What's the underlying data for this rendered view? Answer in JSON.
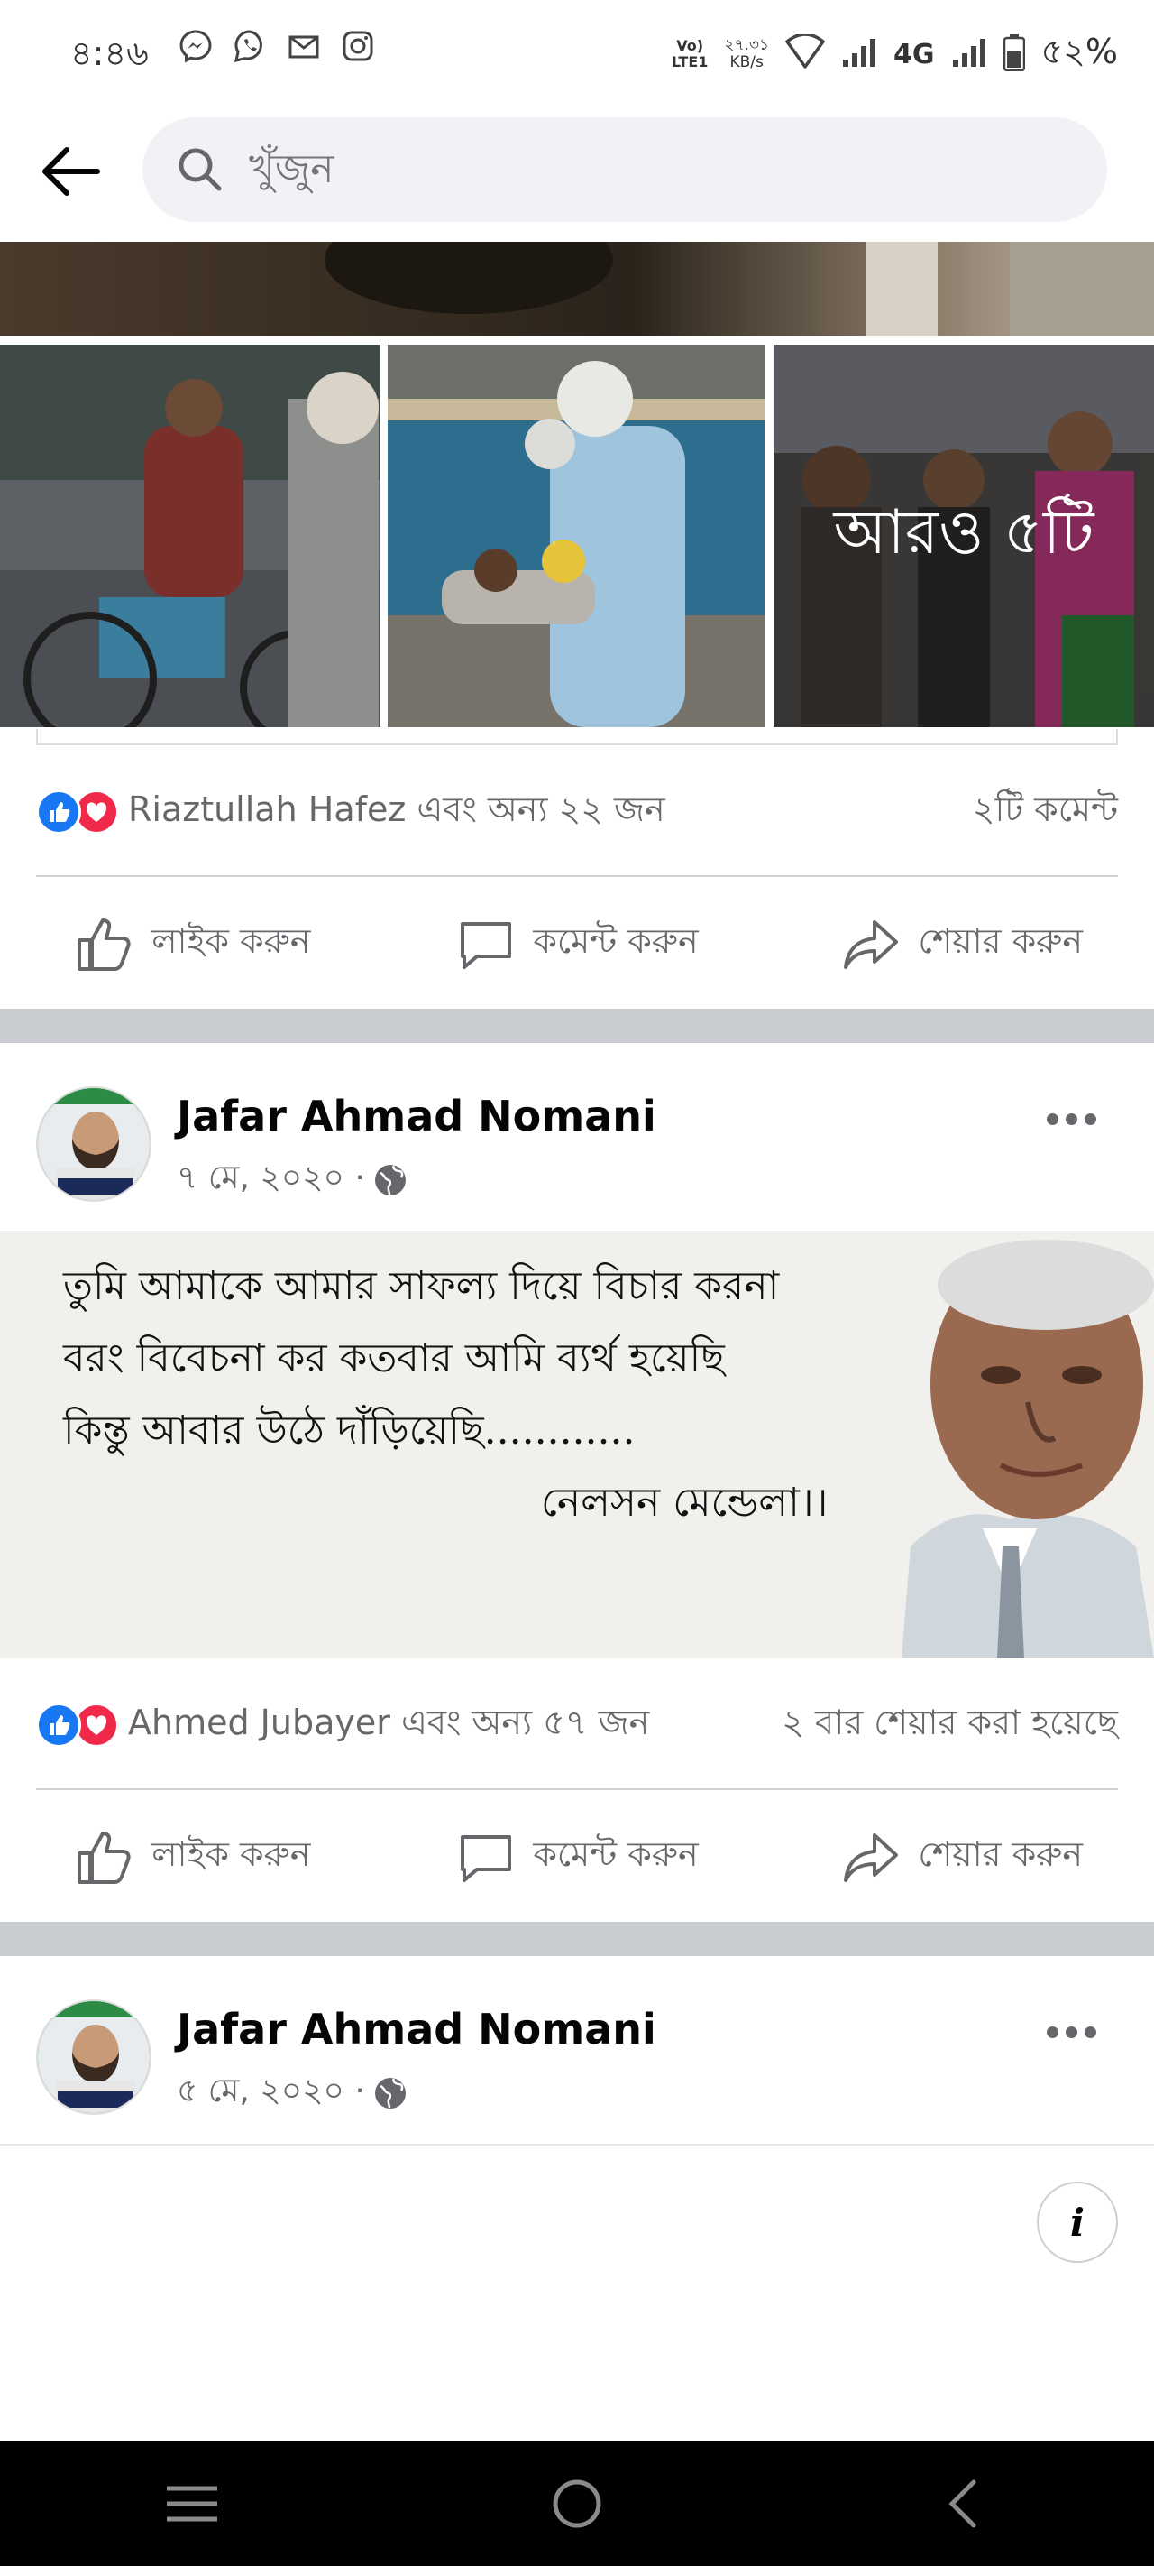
{
  "status_bar": {
    "time": "৪:৪৬",
    "volte_line1": "Vo)",
    "volte_line2": "LTE1",
    "net_speed_value": "২৭.৩১",
    "net_speed_unit": "KB/s",
    "network_type": "4G",
    "battery": "৫২%"
  },
  "search": {
    "placeholder": "খুঁজুন"
  },
  "post1": {
    "more_photos_label": "আরও ৫টি",
    "reactions_text": "Riaztullah Hafez এবং অন্য ২২ জন",
    "comments_count": "২টি কমেন্ট"
  },
  "post2": {
    "author": "Jafar Ahmad Nomani",
    "date": "৭ মে, ২০২০ ·",
    "quote_lines": [
      "তুমি আমাকে আমার সাফল্য দিয়ে বিচার করনা",
      "বরং বিবেচনা কর কতবার আমি ব্যর্থ হয়েছি",
      "কিন্তু আবার উঠে দাঁড়িয়েছি............"
    ],
    "quote_attribution": "নেলসন মেন্ডেলা।।",
    "reactions_text": "Ahmed Jubayer এবং অন্য ৫৭ জন",
    "shares_count": "২ বার শেয়ার করা হয়েছে"
  },
  "post3": {
    "author": "Jafar Ahmad Nomani",
    "date": "৫ মে, ২০২০ ·"
  },
  "actions": {
    "like": "লাইক করুন",
    "comment": "কমেন্ট করুন",
    "share": "শেয়ার করুন"
  },
  "info_button": "i",
  "colors": {
    "like_blue": "#1877f2",
    "love_red": "#f02849",
    "secondary_text": "#65676b",
    "separator_gray": "#c9ccd1"
  }
}
